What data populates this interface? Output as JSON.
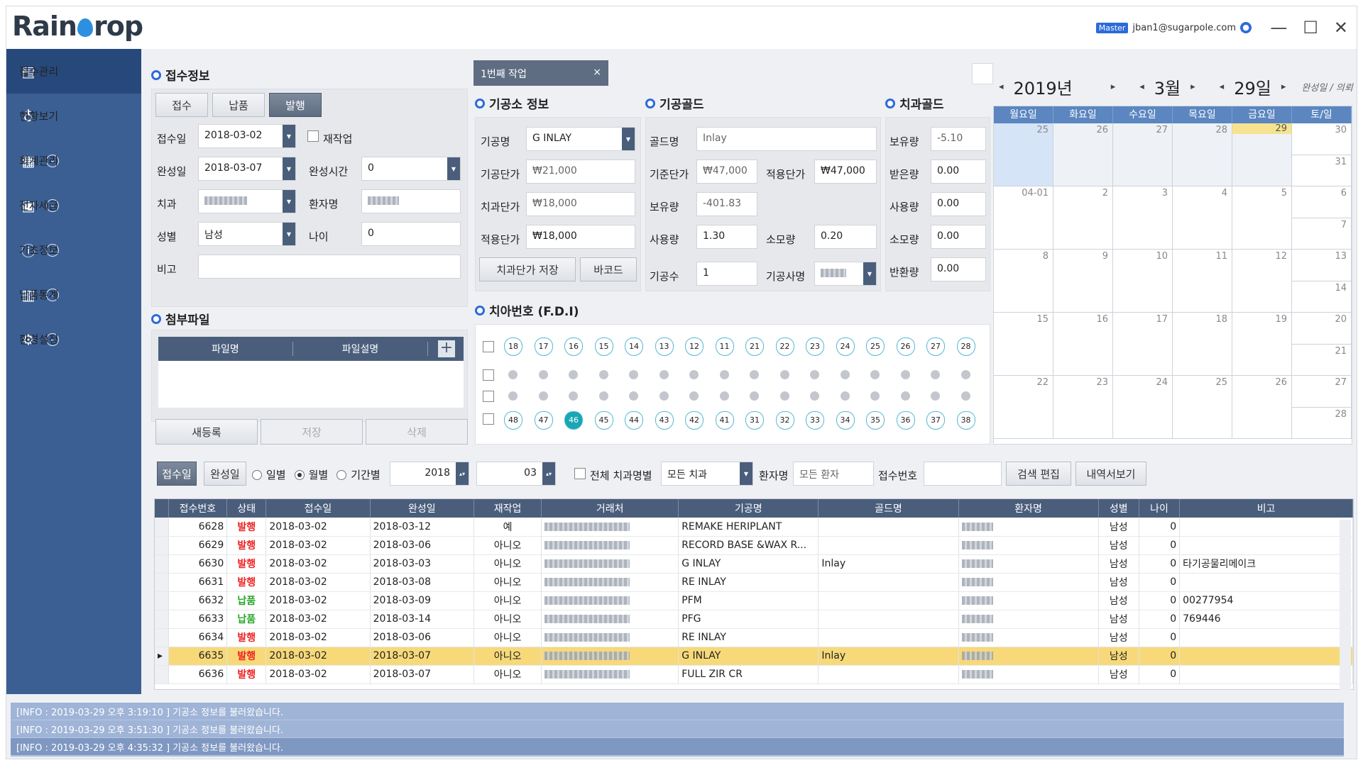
{
  "app": {
    "logo": "Rain",
    "logo2": "rop",
    "badge": "Master",
    "user": "jban1@sugarpole.com",
    "win_min": "—",
    "win_max": "☐",
    "win_close": "✕"
  },
  "sidebar": {
    "items": [
      {
        "label": "접수관리",
        "icon": "document-icon"
      },
      {
        "label": "현황보기",
        "icon": "tooth-icon"
      },
      {
        "label": "회계관리",
        "icon": "calculator-icon"
      },
      {
        "label": "전자세금",
        "icon": "invoice-icon"
      },
      {
        "label": "기초정보",
        "icon": "info-icon"
      },
      {
        "label": "납품통계",
        "icon": "bar-chart-icon"
      },
      {
        "label": "환경설정",
        "icon": "settings-icon"
      }
    ]
  },
  "reception": {
    "title": "접수정보",
    "tabs": [
      "접수",
      "납품",
      "발행"
    ],
    "receipt_date_label": "접수일",
    "receipt_date": "2018-03-02",
    "rework_label": "재작업",
    "complete_date_label": "완성일",
    "complete_date": "2018-03-07",
    "complete_time_label": "완성시간",
    "complete_time": "0",
    "clinic_label": "치과",
    "patient_label": "환자명",
    "gender_label": "성별",
    "gender": "남성",
    "age_label": "나이",
    "age": "0",
    "note_label": "비고"
  },
  "attach": {
    "title": "첨부파일",
    "col_name": "파일명",
    "col_desc": "파일설명",
    "add": "+",
    "new_btn": "새등록",
    "save_btn": "저장",
    "delete_btn": "삭제"
  },
  "work_tab": {
    "label": "1번째 작업",
    "close": "×"
  },
  "lab": {
    "title": "기공소 정보",
    "product_label": "기공명",
    "product": "G INLAY",
    "unit_label": "기공단가",
    "unit": "₩21,000",
    "clinic_price_label": "치과단가",
    "clinic_price": "₩18,000",
    "apply_price_label": "적용단가",
    "apply_price": "₩18,000",
    "save_btn": "치과단가 저장",
    "barcode_btn": "바코드"
  },
  "labgold": {
    "title": "기공골드",
    "gold_label": "골드명",
    "gold": "Inlay",
    "std_label": "기준단가",
    "std": "₩47,000",
    "apply_label": "적용단가",
    "apply": "₩47,000",
    "hold_label": "보유량",
    "hold": "-401.83",
    "use_label": "사용량",
    "use": "1.30",
    "consume_label": "소모량",
    "consume": "0.20",
    "count_label": "기공수",
    "count": "1",
    "tech_label": "기공사명"
  },
  "clinicgold": {
    "title": "치과골드",
    "hold_label": "보유량",
    "hold": "-5.10",
    "recv_label": "받은량",
    "recv": "0.00",
    "use_label": "사용량",
    "use": "0.00",
    "consume_label": "소모량",
    "consume": "0.00",
    "return_label": "반환량",
    "return": "0.00"
  },
  "teeth": {
    "title": "치아번호 (F.D.I)",
    "upper": [
      "18",
      "17",
      "16",
      "15",
      "14",
      "13",
      "12",
      "11",
      "21",
      "22",
      "23",
      "24",
      "25",
      "26",
      "27",
      "28"
    ],
    "lower": [
      "48",
      "47",
      "46",
      "45",
      "44",
      "43",
      "42",
      "41",
      "31",
      "32",
      "33",
      "34",
      "35",
      "36",
      "37",
      "38"
    ],
    "selected": "46"
  },
  "calendar": {
    "year": "2019년",
    "month": "3월",
    "day": "29일",
    "mode": "완성일 / 의뢰",
    "weekdays": [
      "월요일",
      "화요일",
      "수요일",
      "목요일",
      "금요일",
      "토/일"
    ],
    "weeks": [
      [
        "25",
        "26",
        "27",
        "28",
        "29",
        "30|31"
      ],
      [
        "04-01",
        "2",
        "3",
        "4",
        "5",
        "6|7"
      ],
      [
        "8",
        "9",
        "10",
        "11",
        "12",
        "13|14"
      ],
      [
        "15",
        "16",
        "17",
        "18",
        "19",
        "20|21"
      ],
      [
        "22",
        "23",
        "24",
        "25",
        "26",
        "27|28"
      ]
    ],
    "today": "29"
  },
  "filter": {
    "receipt_btn": "접수일",
    "complete_btn": "완성일",
    "daily": "일별",
    "monthly": "월별",
    "period": "기간별",
    "year": "2018",
    "month": "03",
    "all_clinic": "전체 치과명별",
    "clinic": "모든 치과",
    "patient_label": "환자명",
    "patient_ph": "모든 환자",
    "no_label": "접수번호",
    "edit_btn": "검색 편집",
    "detail_btn": "내역서보기"
  },
  "table": {
    "columns": [
      "접수번호",
      "상태",
      "접수일",
      "완성일",
      "재작업",
      "거래처",
      "기공명",
      "골드명",
      "환자명",
      "성별",
      "나이",
      "비고"
    ],
    "rows": [
      [
        "6628",
        "발행",
        "2018-03-02",
        "2018-03-12",
        "예",
        "",
        "REMAKE HERIPLANT",
        "",
        "",
        "남성",
        "0",
        ""
      ],
      [
        "6629",
        "발행",
        "2018-03-02",
        "2018-03-06",
        "아니오",
        "",
        "RECORD BASE &WAX R...",
        "",
        "",
        "남성",
        "0",
        ""
      ],
      [
        "6630",
        "발행",
        "2018-03-02",
        "2018-03-03",
        "아니오",
        "",
        "G INLAY",
        "Inlay",
        "",
        "남성",
        "0",
        "타기공물리메이크"
      ],
      [
        "6631",
        "발행",
        "2018-03-02",
        "2018-03-08",
        "아니오",
        "",
        "RE  INLAY",
        "",
        "",
        "남성",
        "0",
        ""
      ],
      [
        "6632",
        "납품",
        "2018-03-02",
        "2018-03-09",
        "아니오",
        "",
        "PFM",
        "",
        "",
        "남성",
        "0",
        "00277954"
      ],
      [
        "6633",
        "납품",
        "2018-03-02",
        "2018-03-14",
        "아니오",
        "",
        "PFG",
        "",
        "",
        "남성",
        "0",
        "769446"
      ],
      [
        "6634",
        "발행",
        "2018-03-02",
        "2018-03-06",
        "아니오",
        "",
        "RE  INLAY",
        "",
        "",
        "남성",
        "0",
        ""
      ],
      [
        "6635",
        "발행",
        "2018-03-02",
        "2018-03-07",
        "아니오",
        "",
        "G INLAY",
        "Inlay",
        "",
        "남성",
        "0",
        ""
      ],
      [
        "6636",
        "발행",
        "2018-03-02",
        "2018-03-07",
        "아니오",
        "",
        "FULL ZIR CR",
        "",
        "",
        "남성",
        "0",
        ""
      ]
    ],
    "highlight_row": 7
  },
  "log": [
    "[INFO : 2019-03-29 오후 3:19:10 ] 기공소 정보를 불러왔습니다.",
    "[INFO : 2019-03-29 오후 3:51:30 ] 기공소 정보를 불러왔습니다.",
    "[INFO : 2019-03-29 오후 4:35:32 ] 기공소 정보를 불러왔습니다."
  ]
}
